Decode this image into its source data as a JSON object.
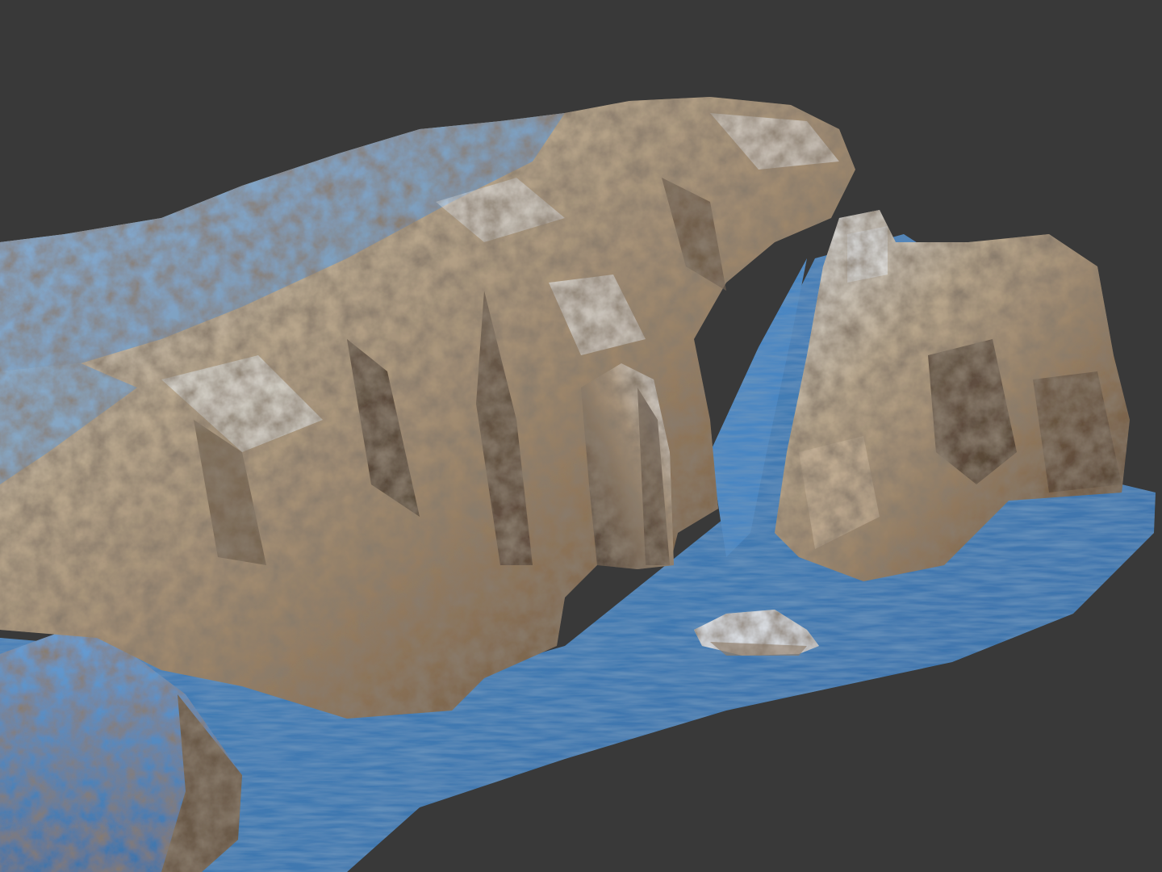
{
  "viewport": {
    "background_color": "#393939"
  },
  "scene": {
    "subject": "3d-terrain-model",
    "colors": {
      "water": "#3f7bb3",
      "water_light": "#6fa3d2",
      "water_shadow": "#2a5380",
      "rock_light": "#d8d4cc",
      "rock_mid": "#9c8870",
      "rock_dark": "#4a3b2e",
      "rock_highlight": "#eef3f8",
      "rim_blue": "#5c90c8"
    }
  }
}
